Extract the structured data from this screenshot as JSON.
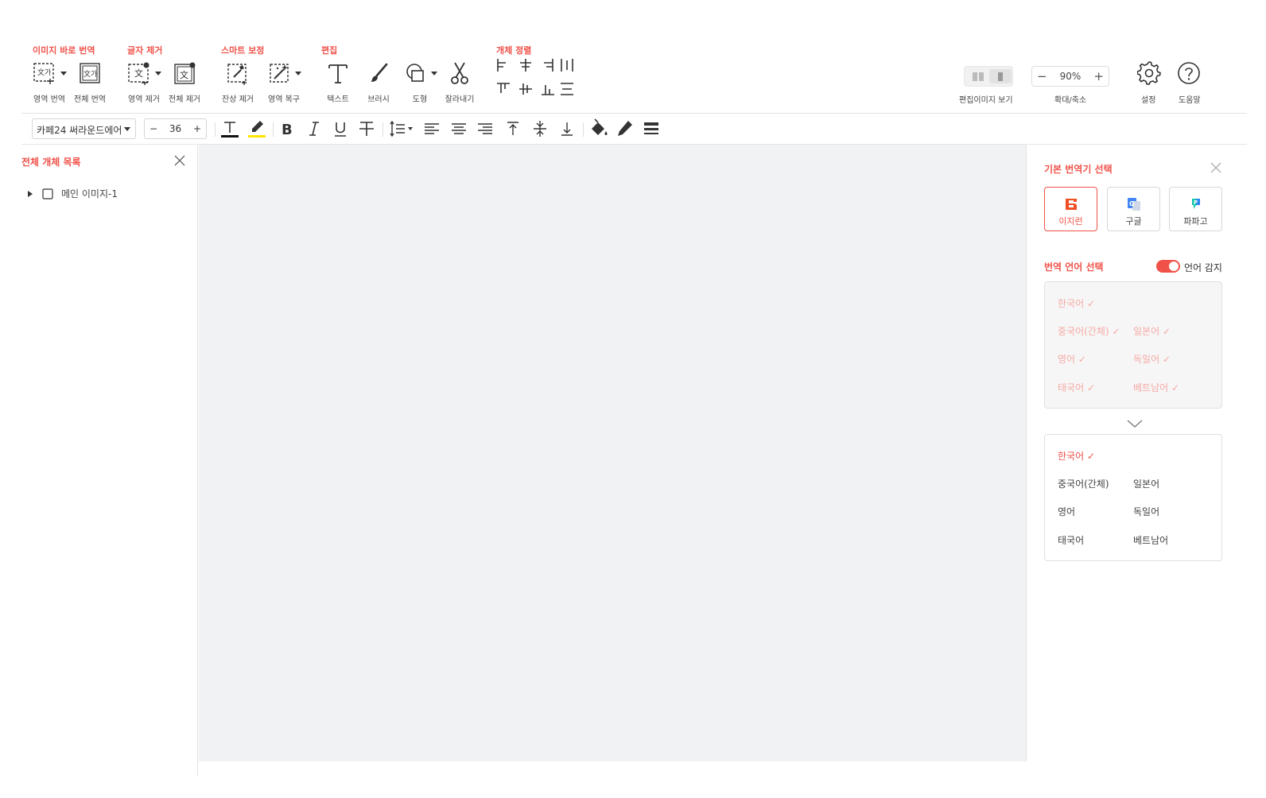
{
  "toolbar": {
    "groups": {
      "instant_translate": "이미지 바로 번역",
      "text_remove": "글자 제거",
      "smart_fix": "스마트 보정",
      "edit": "편집",
      "align": "개체 정렬"
    },
    "tools": {
      "area_translate": "영역 번역",
      "full_translate": "전체 번역",
      "area_remove": "영역 제거",
      "full_remove": "전체 제거",
      "residue_remove": "잔상 제거",
      "area_restore": "영역 복구",
      "text": "텍스트",
      "brush": "브러시",
      "shape": "도형",
      "crop": "잘라내기"
    },
    "view_label": "편집이미지 보기",
    "zoom_value": "90%",
    "zoom_label": "확대/축소",
    "settings_label": "설정",
    "help_label": "도움말"
  },
  "format": {
    "font": "카페24 써라운드에어",
    "size": "36",
    "minus": "−",
    "plus": "+"
  },
  "left_panel": {
    "title": "전체 개체 목록",
    "items": [
      "메인 이미지-1"
    ]
  },
  "right_panel": {
    "title": "기본 번역기 선택",
    "engines": [
      "이지런",
      "구글",
      "파파고"
    ],
    "lang_title": "번역 언어 선택",
    "detect_label": "언어 감지",
    "source_langs": [
      "한국어",
      "중국어(간체)",
      "일본어",
      "영어",
      "독일어",
      "태국어",
      "베트남어"
    ],
    "target_langs": [
      "한국어",
      "중국어(간체)",
      "일본어",
      "영어",
      "독일어",
      "태국어",
      "베트남어"
    ],
    "colors": {
      "accent": "#f0524a"
    }
  }
}
